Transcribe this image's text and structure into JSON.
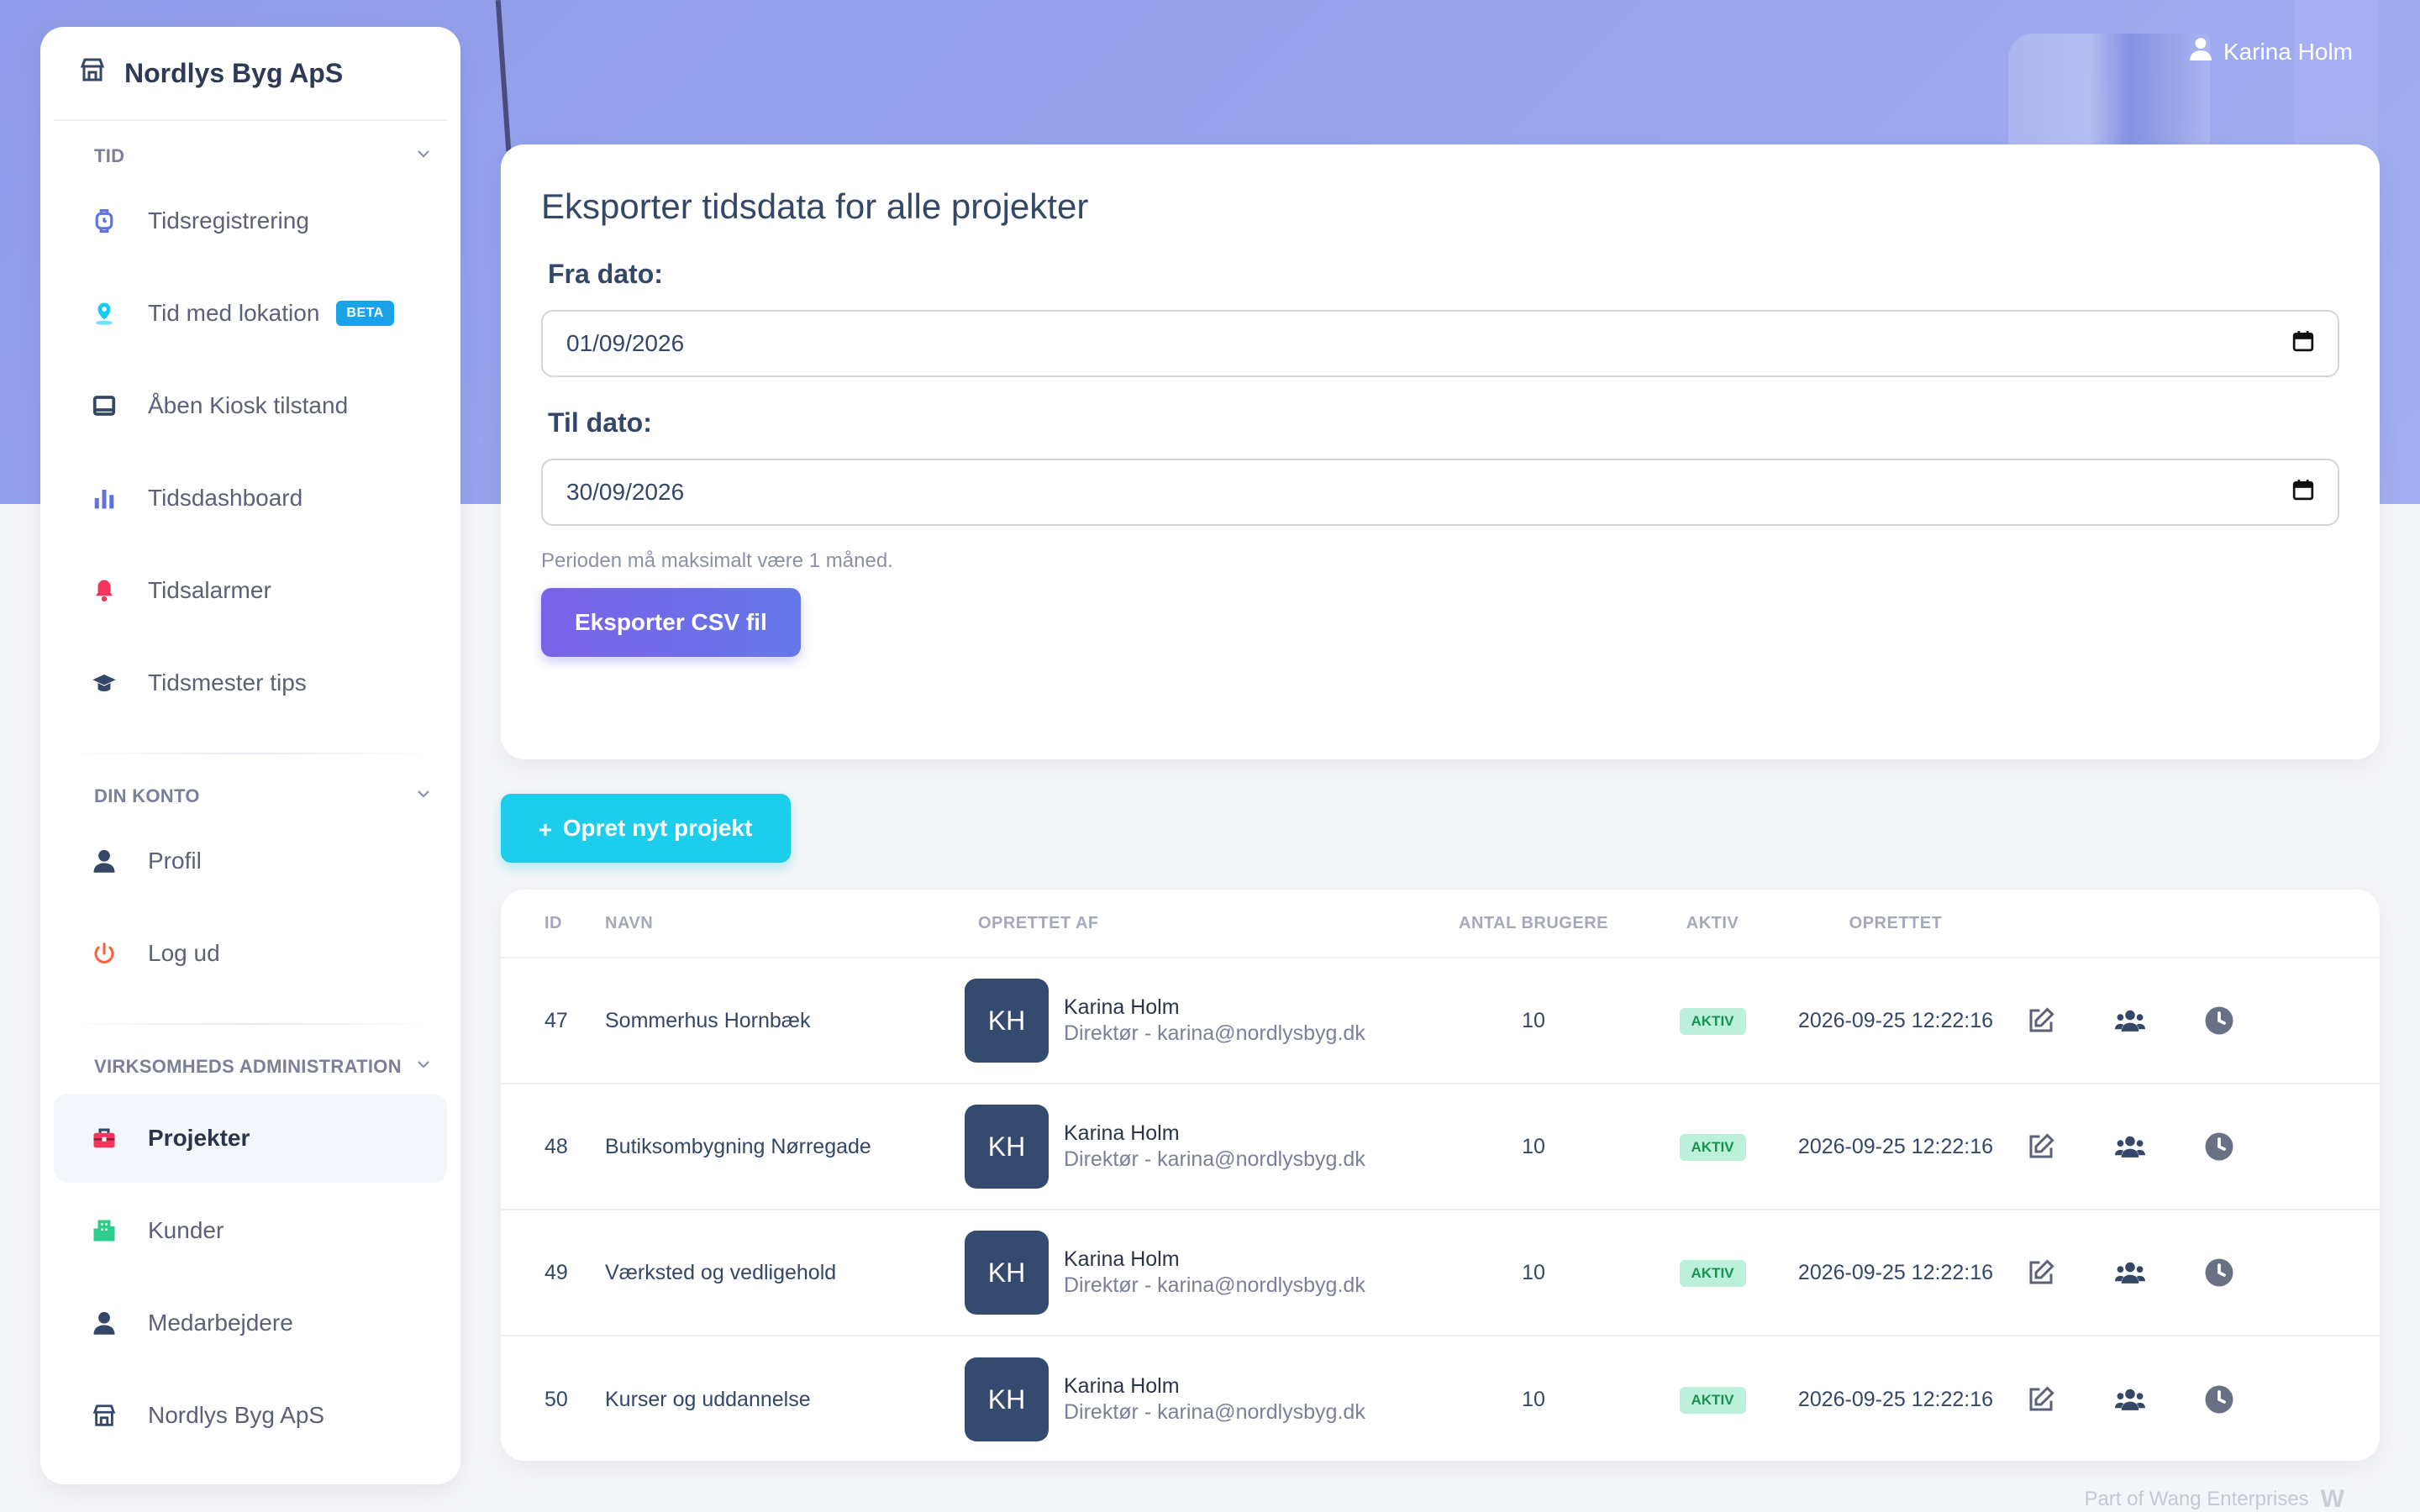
{
  "user": {
    "name": "Karina Holm"
  },
  "brand": {
    "name": "Nordlys Byg ApS"
  },
  "sidebar": {
    "sections": [
      {
        "title": "TID",
        "items": [
          {
            "label": "Tidsregistrering",
            "icon": "watch-icon",
            "color": "#5e72e4"
          },
          {
            "label": "Tid med lokation",
            "icon": "location-pin-icon",
            "color": "#11cdef",
            "badge": "BETA"
          },
          {
            "label": "Åben Kiosk tilstand",
            "icon": "tablet-icon",
            "color": "#344767"
          },
          {
            "label": "Tidsdashboard",
            "icon": "bar-chart-icon",
            "color": "#5e72e4"
          },
          {
            "label": "Tidsalarmer",
            "icon": "bell-icon",
            "color": "#f5365c"
          },
          {
            "label": "Tidsmester tips",
            "icon": "graduation-cap-icon",
            "color": "#344767"
          }
        ]
      },
      {
        "title": "DIN KONTO",
        "items": [
          {
            "label": "Profil",
            "icon": "user-icon",
            "color": "#344767"
          },
          {
            "label": "Log ud",
            "icon": "power-icon",
            "color": "#fb6340"
          }
        ]
      },
      {
        "title": "VIRKSOMHEDS ADMINISTRATION",
        "items": [
          {
            "label": "Projekter",
            "icon": "briefcase-icon",
            "color": "#f5365c",
            "active": true
          },
          {
            "label": "Kunder",
            "icon": "building-icon",
            "color": "#2dce89"
          },
          {
            "label": "Medarbejdere",
            "icon": "user-icon",
            "color": "#344767"
          },
          {
            "label": "Nordlys Byg ApS",
            "icon": "shop-icon",
            "color": "#344767"
          }
        ]
      }
    ]
  },
  "export": {
    "title": "Eksporter tidsdata for alle projekter",
    "from_label": "Fra dato:",
    "from_value": "01/09/2026",
    "to_label": "Til dato:",
    "to_value": "30/09/2026",
    "hint": "Perioden må maksimalt være 1 måned.",
    "button": "Eksporter CSV fil"
  },
  "create_button": "Opret nyt projekt",
  "table": {
    "headers": {
      "id": "ID",
      "name": "NAVN",
      "by": "OPRETTET AF",
      "users": "ANTAL BRUGERE",
      "active": "AKTIV",
      "created": "OPRETTET"
    },
    "rows": [
      {
        "id": "47",
        "name": "Sommerhus Hornbæk",
        "initials": "KH",
        "by_name": "Karina Holm",
        "by_sub": "Direktør - karina@nordlysbyg.dk",
        "users": "10",
        "active": "AKTIV",
        "created": "2026-09-25 12:22:16"
      },
      {
        "id": "48",
        "name": "Butiksombygning Nørregade",
        "initials": "KH",
        "by_name": "Karina Holm",
        "by_sub": "Direktør - karina@nordlysbyg.dk",
        "users": "10",
        "active": "AKTIV",
        "created": "2026-09-25 12:22:16"
      },
      {
        "id": "49",
        "name": "Værksted og vedligehold",
        "initials": "KH",
        "by_name": "Karina Holm",
        "by_sub": "Direktør - karina@nordlysbyg.dk",
        "users": "10",
        "active": "AKTIV",
        "created": "2026-09-25 12:22:16"
      },
      {
        "id": "50",
        "name": "Kurser og uddannelse",
        "initials": "KH",
        "by_name": "Karina Holm",
        "by_sub": "Direktør - karina@nordlysbyg.dk",
        "users": "10",
        "active": "AKTIV",
        "created": "2026-09-25 12:22:16"
      }
    ]
  },
  "footer": "Part of Wang Enterprises"
}
